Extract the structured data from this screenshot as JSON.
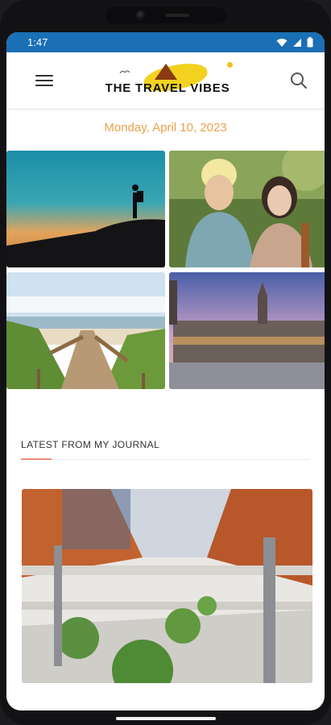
{
  "status_bar": {
    "time": "1:47",
    "icons": [
      "wifi-icon",
      "signal-icon",
      "battery-icon"
    ]
  },
  "app_bar": {
    "logo_text": "THE TRAVEL VIBES",
    "menu_icon": "menu-icon",
    "search_icon": "search-icon"
  },
  "date_text": "Monday, April 10, 2023",
  "gallery": [
    {
      "name": "gallery-photo-hiker-silhouette"
    },
    {
      "name": "gallery-photo-travel-couple"
    },
    {
      "name": "gallery-photo-beach-boardwalk"
    },
    {
      "name": "gallery-photo-city-palace"
    }
  ],
  "journal": {
    "heading": "LATEST FROM MY JOURNAL",
    "accent_color": "#f08a7a"
  },
  "colors": {
    "status_bar": "#1a6fb5",
    "date": "#e8a24a",
    "logo_blob": "#f2d21f"
  }
}
